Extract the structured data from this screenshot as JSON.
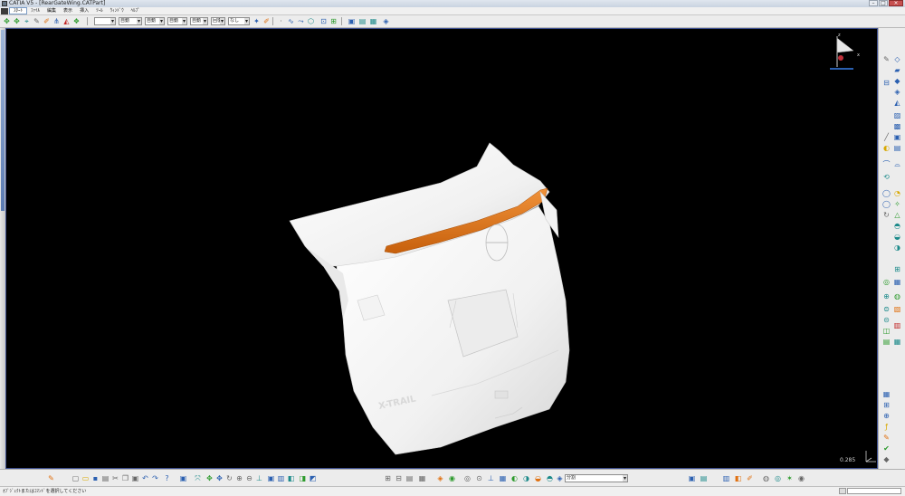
{
  "window": {
    "title": "CATIA V5 - [RearGateWing.CATPart]"
  },
  "menu": {
    "items": [
      "ｽﾀｰﾄ",
      "ﾌｧｲﾙ",
      "編集",
      "表示",
      "挿入",
      "ﾂｰﾙ",
      "ｳｨﾝﾄﾞｳ",
      "ﾍﾙﾌﾟ"
    ],
    "active_index": 0
  },
  "toolbar": {
    "combos": [
      {
        "name": "color-combo",
        "value": ""
      },
      {
        "name": "transparency-combo",
        "value": "自動"
      },
      {
        "name": "linewidth-combo",
        "value": "自動"
      },
      {
        "name": "linetype-combo",
        "value": "自動"
      },
      {
        "name": "point-symbol-combo",
        "value": "自動"
      },
      {
        "name": "layer-combo",
        "value": "回復..."
      },
      {
        "name": "render-style-combo",
        "value": "なし"
      }
    ]
  },
  "bottom_toolbar": {
    "combo_value": "分割"
  },
  "status": {
    "message": "ｵﾌﾞｼﾞｪｸﾄまたはｺﾏﾝﾄﾞを選択してください"
  },
  "viewport": {
    "scale_label": "0.285",
    "compass_labels": {
      "z": "z",
      "x": "x",
      "y": "y"
    },
    "model_colors": {
      "body": "#f2f2f2",
      "spoiler": "#e07a18",
      "background": "#000000"
    },
    "model_text": "X-TRAIL"
  },
  "right_toolbar": {
    "icon_names": [
      "sketch-icon",
      "plane-icon",
      "pad-icon",
      "pocket-icon",
      "fillet-icon",
      "chamfer-icon",
      "shell-icon",
      "thickness-icon",
      "line-icon",
      "curve-icon",
      "extrude-icon",
      "revolve-icon",
      "sweep-icon",
      "loft-icon",
      "join-icon",
      "split-icon",
      "trim-icon",
      "offset-icon",
      "measure-icon",
      "analysis-icon"
    ]
  },
  "bottom_icons": {
    "icon_names": [
      "new-icon",
      "open-icon",
      "save-icon",
      "print-icon",
      "cut-icon",
      "copy-icon",
      "paste-icon",
      "undo-icon",
      "redo-icon",
      "help-icon",
      "fly-icon",
      "fit-all-icon",
      "pan-icon",
      "rotate-icon",
      "zoom-in-icon",
      "zoom-out-icon",
      "normal-view-icon",
      "views-icon",
      "render-icon",
      "hide-icon",
      "swap-icon"
    ]
  }
}
